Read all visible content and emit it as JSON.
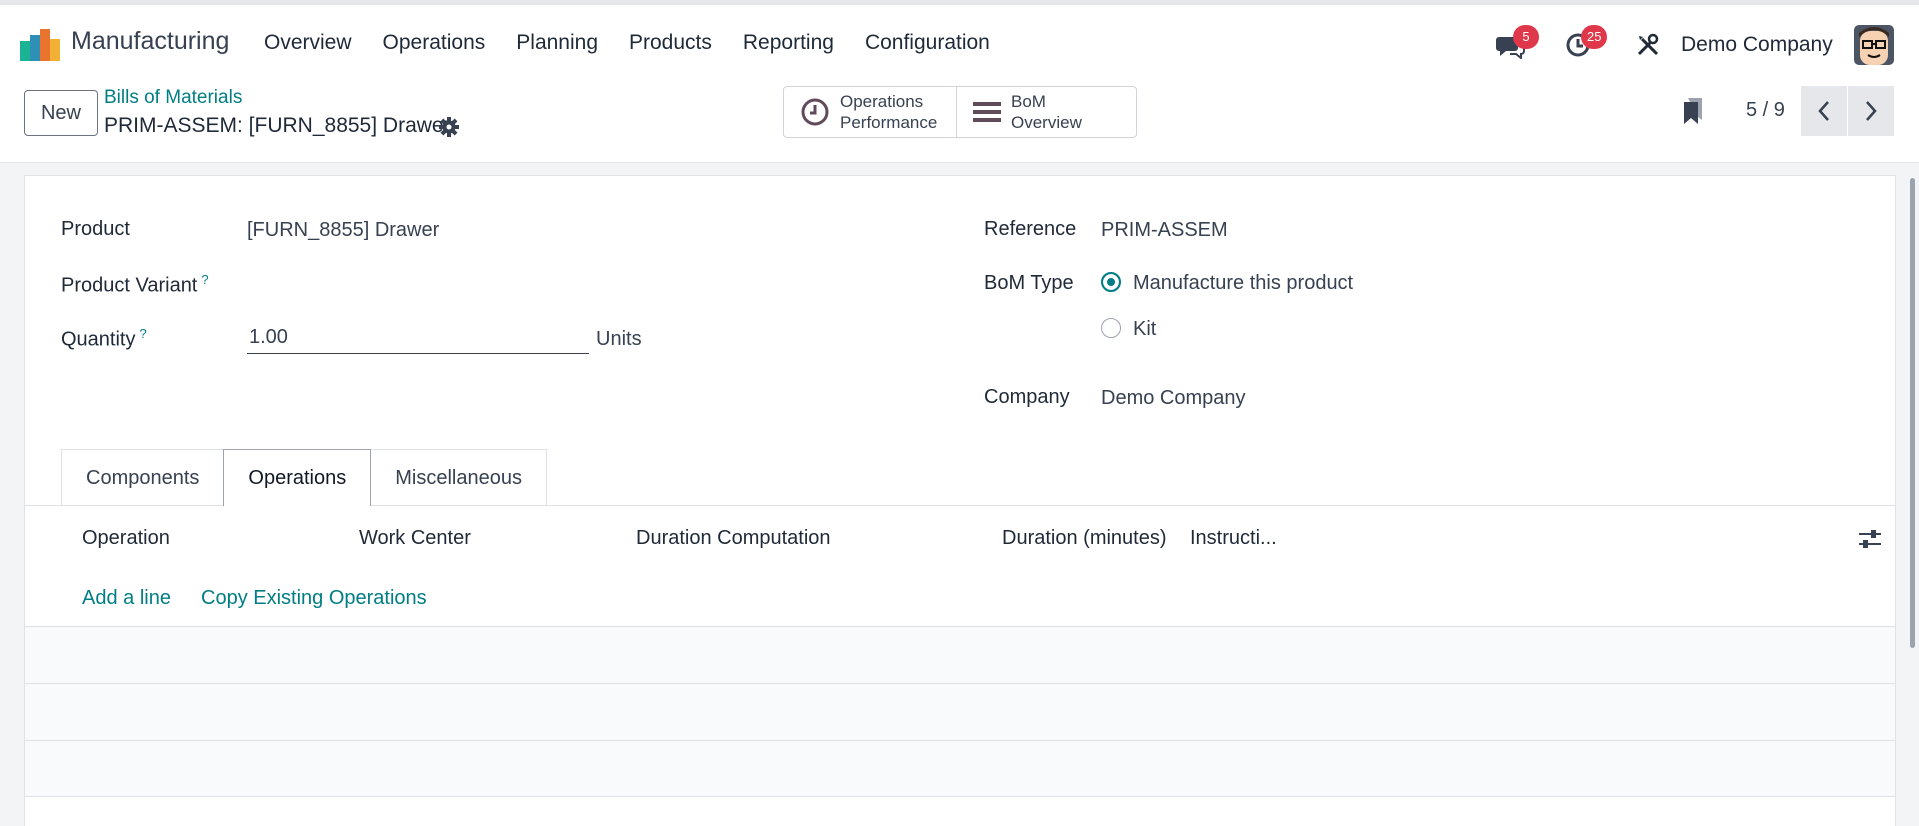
{
  "app": {
    "name": "Manufacturing",
    "menu": [
      "Overview",
      "Operations",
      "Planning",
      "Products",
      "Reporting",
      "Configuration"
    ]
  },
  "systray": {
    "messages_count": "5",
    "activities_count": "25",
    "company": "Demo Company"
  },
  "control_panel": {
    "new_label": "New",
    "breadcrumb": "Bills of Materials",
    "record_title": "PRIM-ASSEM: [FURN_8855] Drawer",
    "smart_buttons": {
      "operations_performance": [
        "Operations",
        "Performance"
      ],
      "bom_overview": "BoM Overview"
    },
    "pager": "5 / 9"
  },
  "form": {
    "product_label": "Product",
    "product_value": "[FURN_8855] Drawer",
    "variant_label": "Product Variant",
    "quantity_label": "Quantity",
    "quantity_value": "1.00",
    "quantity_uom": "Units",
    "help_mark": "?",
    "reference_label": "Reference",
    "reference_value": "PRIM-ASSEM",
    "bom_type_label": "BoM Type",
    "bom_type_options": [
      "Manufacture this product",
      "Kit"
    ],
    "bom_type_selected": "Manufacture this product",
    "company_label": "Company",
    "company_value": "Demo Company"
  },
  "tabs": [
    "Components",
    "Operations",
    "Miscellaneous"
  ],
  "active_tab": "Operations",
  "operations_table": {
    "columns": [
      "Operation",
      "Work Center",
      "Duration Computation",
      "Duration (minutes)",
      "Instructi..."
    ],
    "add_line": "Add a line",
    "copy_existing": "Copy Existing Operations"
  },
  "colors": {
    "accent": "#017e84",
    "badge": "#e0384b",
    "text": "#374151"
  }
}
